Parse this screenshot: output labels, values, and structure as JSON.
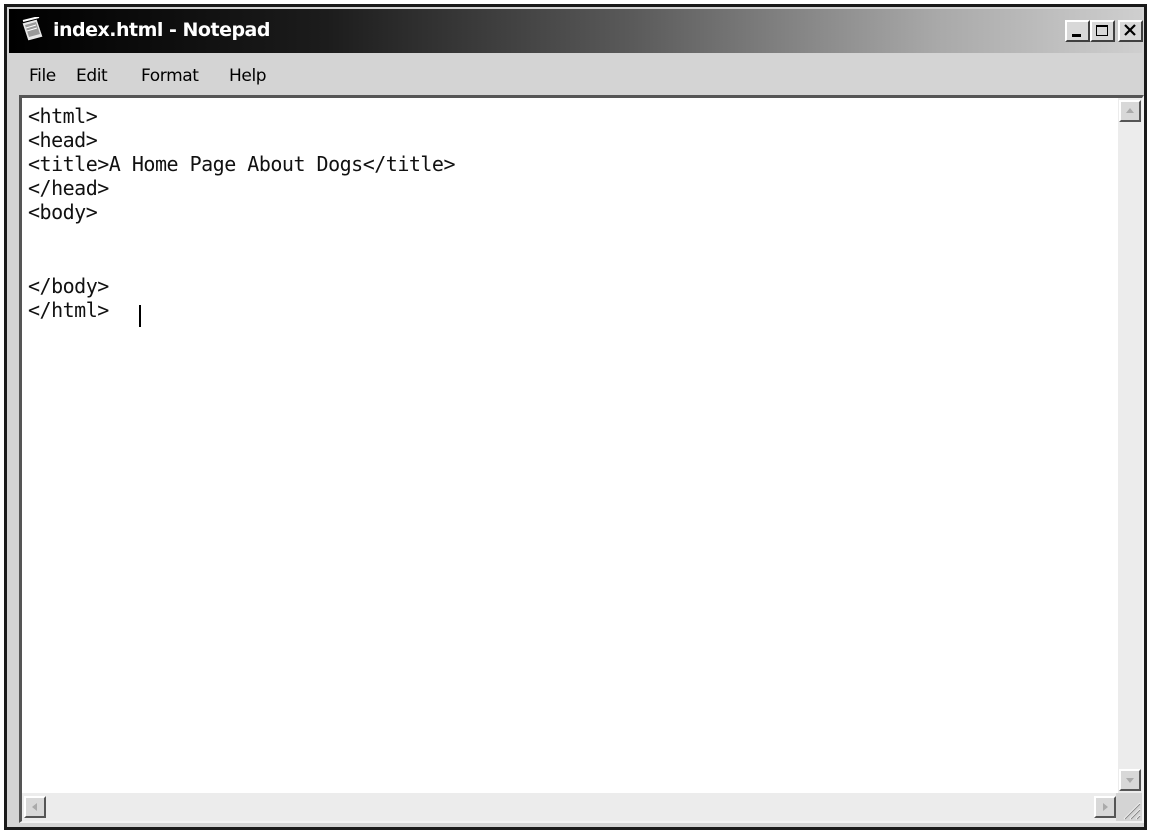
{
  "window": {
    "title": "index.html - Notepad",
    "icon": "notepad-icon",
    "controls": {
      "minimize_icon": "minimize-icon",
      "maximize_icon": "maximize-icon",
      "close_icon": "close-icon"
    }
  },
  "menu": {
    "items": [
      "File",
      "Edit",
      "Format",
      "Help"
    ]
  },
  "editor": {
    "lines": [
      "<html>",
      "<head>",
      "<title>A Home Page About Dogs</title>",
      "</head>",
      "<body>",
      "",
      "",
      "</body>",
      "</html>"
    ]
  },
  "scrollbars": {
    "up_icon": "scroll-up-arrow-icon",
    "down_icon": "scroll-down-arrow-icon",
    "left_icon": "scroll-left-arrow-icon",
    "right_icon": "scroll-right-arrow-icon",
    "grip_icon": "resize-grip-icon"
  }
}
